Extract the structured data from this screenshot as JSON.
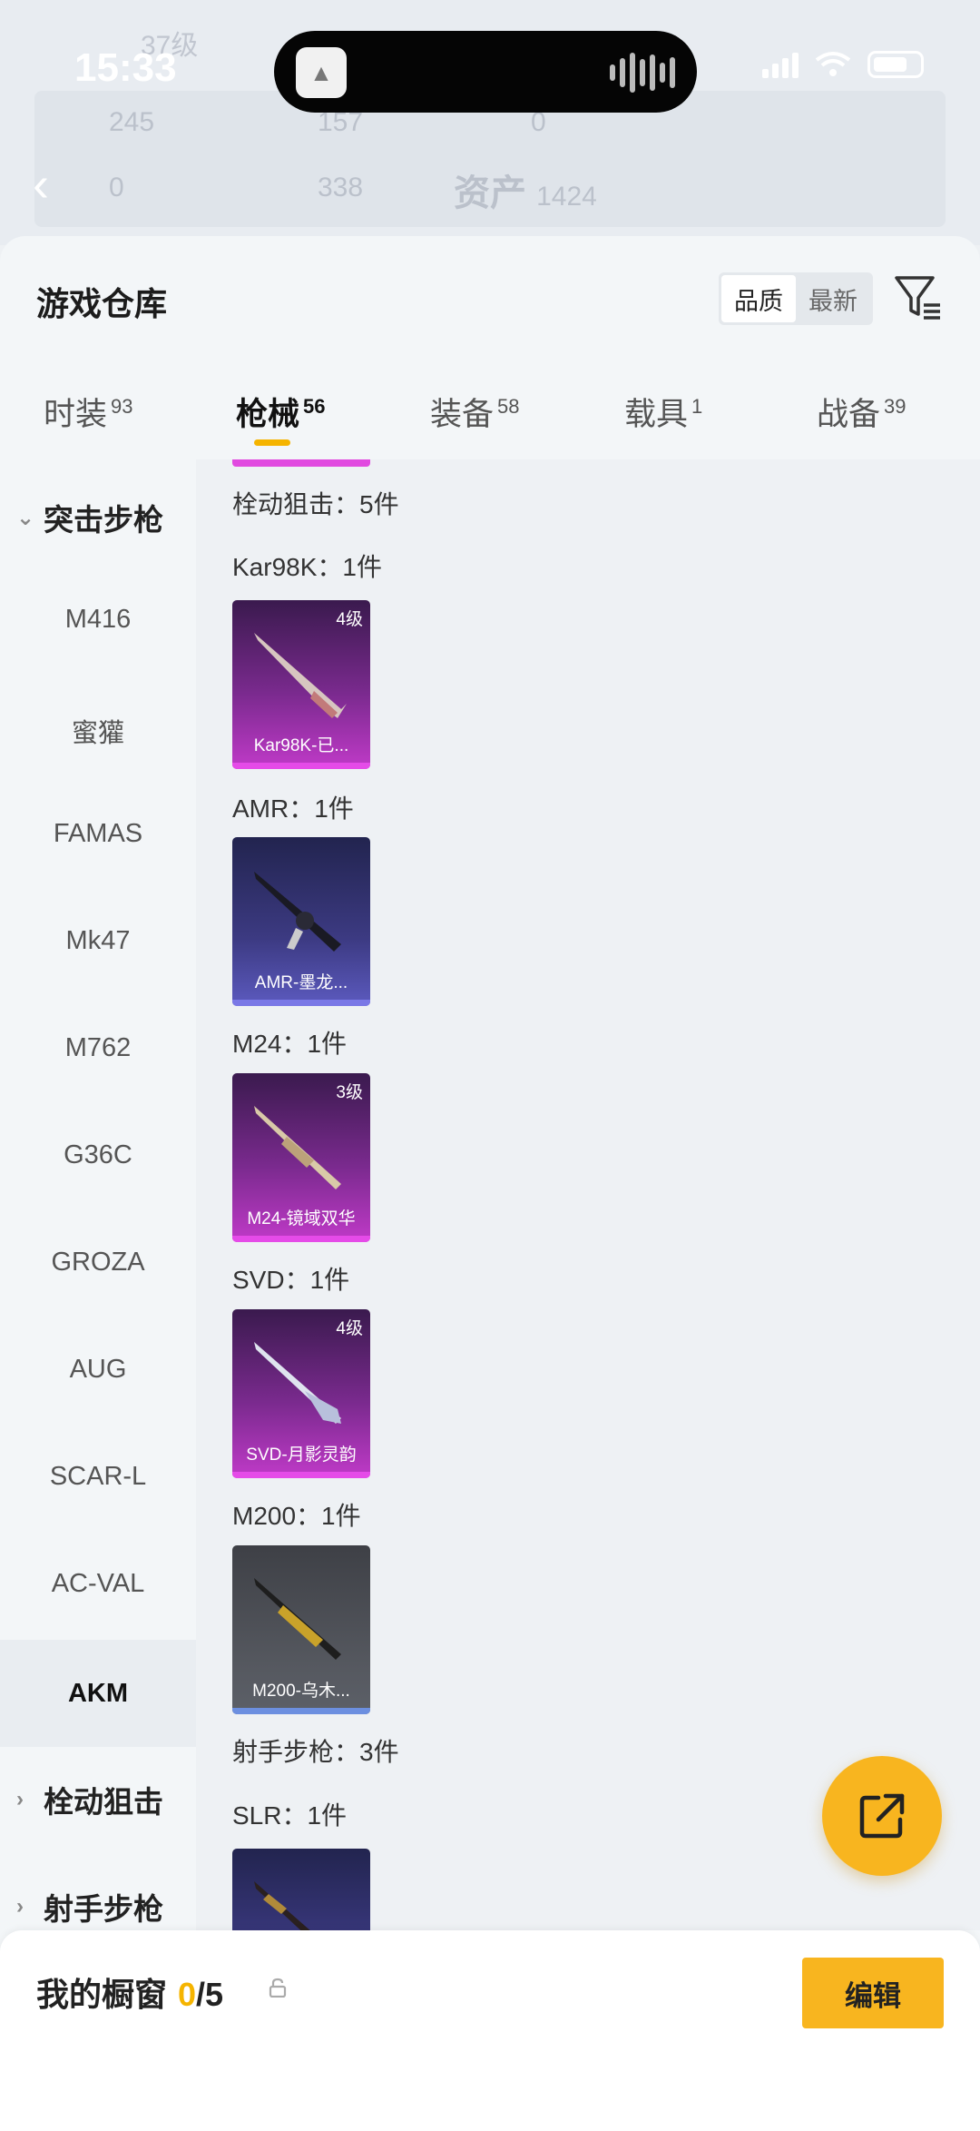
{
  "status_bar": {
    "time": "15:33"
  },
  "background_header": {
    "assets_label": "资产",
    "assets_value": "1424",
    "level": "37级",
    "stats": [
      "245",
      "157",
      "0",
      "0",
      "338"
    ]
  },
  "sheet": {
    "title": "游戏仓库",
    "sort": {
      "quality": "品质",
      "latest": "最新"
    },
    "tabs": [
      {
        "label": "时装",
        "count": "93"
      },
      {
        "label": "枪械",
        "count": "56"
      },
      {
        "label": "装备",
        "count": "58"
      },
      {
        "label": "载具",
        "count": "1"
      },
      {
        "label": "战备",
        "count": "39"
      }
    ]
  },
  "sidebar": {
    "group_assault": "突击步枪",
    "items": [
      "M416",
      "蜜獾",
      "FAMAS",
      "Mk47",
      "M762",
      "G36C",
      "GROZA",
      "AUG",
      "SCAR-L",
      "AC-VAL",
      "AKM"
    ],
    "group_bolt": "栓动狙击",
    "group_marksman": "射手步枪"
  },
  "content": {
    "section_bolt": "栓动狙击：5件",
    "kar98k_label": "Kar98K：1件",
    "kar98k_card": {
      "level": "4级",
      "name": "Kar98K-已..."
    },
    "amr_label": "AMR：1件",
    "amr_card": {
      "name": "AMR-墨龙..."
    },
    "m24_label": "M24：1件",
    "m24_card": {
      "level": "3级",
      "name": "M24-镜域双华"
    },
    "svd_label": "SVD：1件",
    "svd_card": {
      "level": "4级",
      "name": "SVD-月影灵韵"
    },
    "m200_label": "M200：1件",
    "m200_card": {
      "name": "M200-乌木..."
    },
    "section_marksman": "射手步枪：3件",
    "slr_label": "SLR：1件"
  },
  "bottom_bar": {
    "title": "我的橱窗",
    "count_now": "0",
    "count_total": "/5",
    "edit_label": "编辑"
  },
  "colors": {
    "accent": "#f5b400",
    "fab": "#f8b51f",
    "legendary_bar": "#e54be8",
    "epic_bar": "#7a78e6",
    "rare_bar": "#6c8fe0"
  }
}
